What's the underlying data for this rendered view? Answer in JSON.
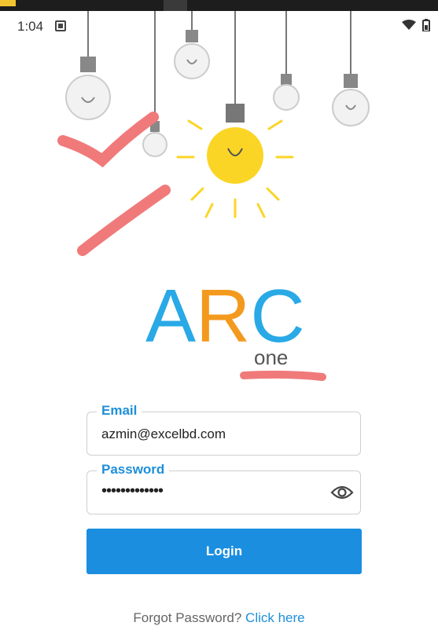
{
  "status_bar": {
    "time": "1:04",
    "notification_icon": "photo-icon",
    "wifi_icon": "wifi-icon",
    "battery_icon": "battery-icon"
  },
  "logo": {
    "main": "ARC",
    "sub": "one"
  },
  "colors": {
    "accent": "#1e8fd8",
    "button": "#1b8ee0",
    "logo_blue": "#29a9e6",
    "logo_orange": "#f39a1e",
    "annotation": "#f07a7a",
    "bulb_yellow": "#fbd526"
  },
  "form": {
    "email": {
      "label": "Email",
      "value": "azmin@excelbd.com"
    },
    "password": {
      "label": "Password",
      "value": "•••••••••••••",
      "toggle_icon": "eye-icon"
    },
    "login_label": "Login"
  },
  "footer": {
    "question": "Forgot Password?",
    "link": "Click here"
  }
}
